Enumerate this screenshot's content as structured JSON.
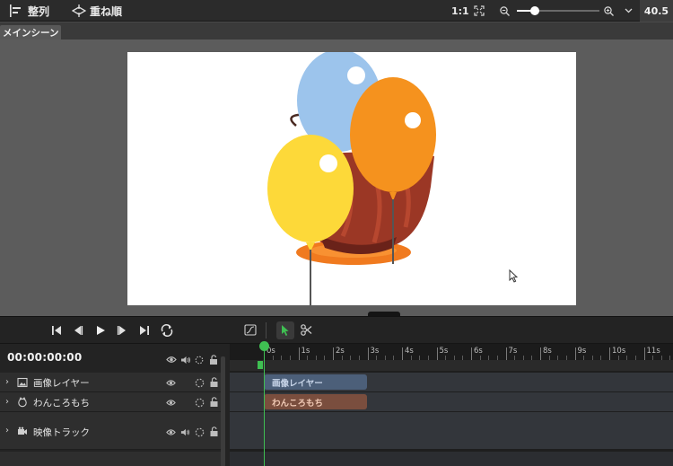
{
  "toolbar": {
    "align_label": "整列",
    "stack_label": "重ね順",
    "zoom_reset_label": "1:1",
    "zoom_value": "40.5",
    "zoom_level_fraction": 0.22
  },
  "scene_tab": {
    "label": "メインシーン"
  },
  "timeline": {
    "timecode": "00:00:00:00",
    "ruler_labels": [
      "0s",
      "1s",
      "2s",
      "3s",
      "4s",
      "5s",
      "6s",
      "7s",
      "8s",
      "9s",
      "10s",
      "11s"
    ],
    "tracks": [
      {
        "name": "画像レイヤー",
        "icon": "image-icon"
      },
      {
        "name": "わんころもち",
        "icon": "character-icon"
      },
      {
        "name": "映像トラック",
        "icon": "video-icon"
      }
    ],
    "clips": [
      {
        "label": "画像レイヤー",
        "color": "#4c5f79",
        "text_color": "#c9d6ea"
      },
      {
        "label": "わんころもち",
        "color": "#7a4e3e",
        "text_color": "#f0c9b5"
      }
    ]
  },
  "colors": {
    "accent": "#3fbf52",
    "balloon_blue": "#9cc4ec",
    "balloon_orange": "#f5921e",
    "balloon_yellow": "#fdd939",
    "bowl": "#9b3725"
  }
}
